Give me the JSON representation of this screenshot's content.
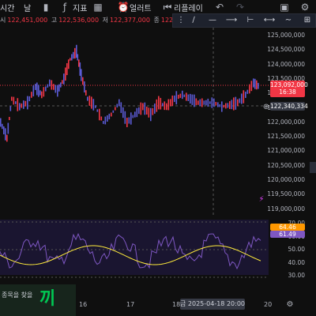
{
  "toolbar": {
    "timeframe_partial": "시간",
    "interval_partial": "날",
    "chart_type_icon": "candles-icon",
    "indicators_label": "지표",
    "indicators_icon": "indicators-icon",
    "layouts_icon": "layout-grid-icon",
    "alert_label": "얼러트",
    "alert_icon": "alarm-clock-icon",
    "replay_label": "리플레이",
    "replay_icon": "replay-icon",
    "undo_icon": "undo-icon",
    "redo_icon": "redo-icon"
  },
  "ohlc": {
    "open_label": "시",
    "open": "122,451,000",
    "high_label": "고",
    "high": "122,536,000",
    "low_label": "저",
    "low": "122,377,000",
    "close_label": "종",
    "close": "122,483,000"
  },
  "drawing_tools": [
    "trend-line-icon",
    "horizontal-line-icon",
    "ray-icon",
    "horizontal-ray-icon",
    "extended-line-icon",
    "brush-icon",
    "cross-line-icon"
  ],
  "price_axis": [
    "125,000,000",
    "124,500,000",
    "124,000,000",
    "123,500,000",
    "123,000,000",
    "122,500,000",
    "122,000,000",
    "121,500,000",
    "121,000,000",
    "120,500,000",
    "120,000,000",
    "119,500,000",
    "119,000,000"
  ],
  "current_price": {
    "value": "123,092,000",
    "countdown": "16:38",
    "color": "#f23645"
  },
  "crosshair_price": {
    "value": "122,340,334",
    "color": "#363a45"
  },
  "rsi_axis": [
    "70.00",
    "60.00",
    "50.00",
    "40.00",
    "30.00"
  ],
  "rsi_values": {
    "rsi": "64.46",
    "rsi_color": "#ff9800",
    "ma": "61.49",
    "ma_color": "#7e57c2"
  },
  "time_axis": [
    "16",
    "17",
    "18",
    "20"
  ],
  "crosshair_time": "금 2025-04-18  20:00",
  "banner": {
    "text": "종목을 찾을",
    "big": "끼"
  },
  "colors": {
    "up": "#f23645",
    "down": "#5b5bd6",
    "rsi_line": "#7e57c2",
    "rsi_ma": "#ffeb3b",
    "background": "#0f0f0f"
  }
}
